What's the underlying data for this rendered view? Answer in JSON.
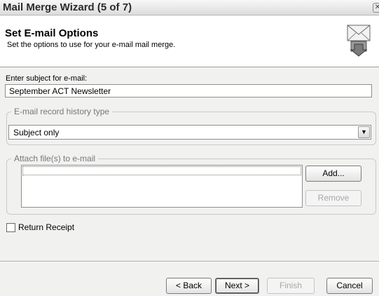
{
  "window": {
    "title": "Mail Merge Wizard (5 of 7)"
  },
  "header": {
    "title": "Set E-mail Options",
    "subtitle": "Set the options to use for your e-mail mail merge."
  },
  "subject": {
    "label": "Enter subject for e-mail:",
    "value": "September ACT Newsletter"
  },
  "history": {
    "legend": "E-mail record history type",
    "selected": "Subject only"
  },
  "attach": {
    "legend": "Attach file(s) to e-mail",
    "files": [],
    "add_label": "Add...",
    "remove_label": "Remove"
  },
  "return_receipt": {
    "label": "Return Receipt",
    "checked": false
  },
  "footer": {
    "back_label": "< Back",
    "next_label": "Next >",
    "finish_label": "Finish",
    "cancel_label": "Cancel"
  },
  "icons": {
    "close": "close-icon",
    "header": "mail-merge-envelope-icon",
    "dropdown": "chevron-down-icon"
  }
}
